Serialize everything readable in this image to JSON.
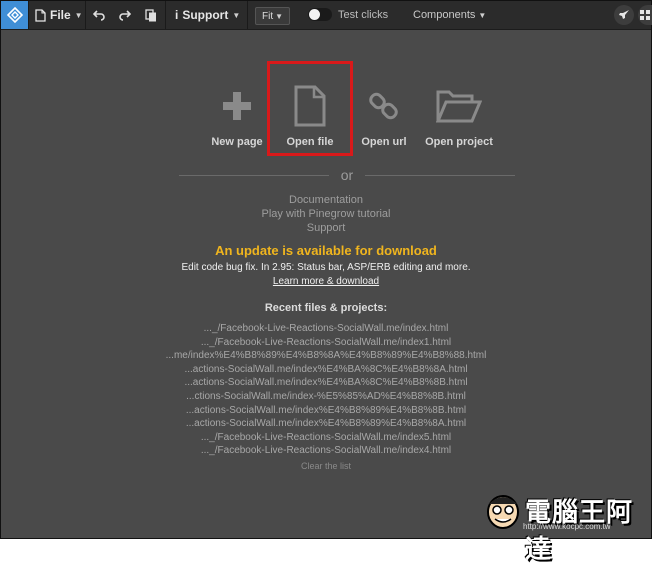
{
  "toolbar": {
    "file_label": "File",
    "support_label": "Support",
    "fit_label": "Fit",
    "test_clicks_label": "Test clicks",
    "components_label": "Components"
  },
  "start": {
    "actions": [
      {
        "label": "New page",
        "icon": "plus-icon"
      },
      {
        "label": "Open file",
        "icon": "file-icon"
      },
      {
        "label": "Open url",
        "icon": "link-icon"
      },
      {
        "label": "Open project",
        "icon": "folder-open-icon"
      }
    ],
    "or_label": "or",
    "links": [
      "Documentation",
      "Play with Pinegrow tutorial",
      "Support"
    ]
  },
  "update": {
    "title": "An update is available for download",
    "description": "Edit code bug fix. In 2.95: Status bar, ASP/ERB editing and more.",
    "learn_more": "Learn more & download"
  },
  "recent": {
    "title": "Recent files & projects:",
    "items": [
      "..._/Facebook-Live-Reactions-SocialWall.me/index.html",
      "..._/Facebook-Live-Reactions-SocialWall.me/index1.html",
      "...me/index%E4%B8%89%E4%B8%8A%E4%B8%89%E4%B8%88.html",
      "...actions-SocialWall.me/index%E4%BA%8C%E4%B8%8A.html",
      "...actions-SocialWall.me/index%E4%BA%8C%E4%B8%8B.html",
      "...ctions-SocialWall.me/index-%E5%85%AD%E4%B8%8B.html",
      "...actions-SocialWall.me/index%E4%B8%89%E4%B8%8B.html",
      "...actions-SocialWall.me/index%E4%B8%89%E4%B8%8A.html",
      "..._/Facebook-Live-Reactions-SocialWall.me/index5.html",
      "..._/Facebook-Live-Reactions-SocialWall.me/index4.html"
    ],
    "clear_label": "Clear the list"
  },
  "watermark": {
    "text": "電腦王阿達",
    "url": "http://www.kocpc.com.tw"
  },
  "colors": {
    "toolbar_bg": "#2b2b2b",
    "workspace_bg": "#4a4a4a",
    "accent_blue": "#3f8ed6",
    "update_yellow": "#f0b51e",
    "highlight_red": "#d9191a"
  }
}
